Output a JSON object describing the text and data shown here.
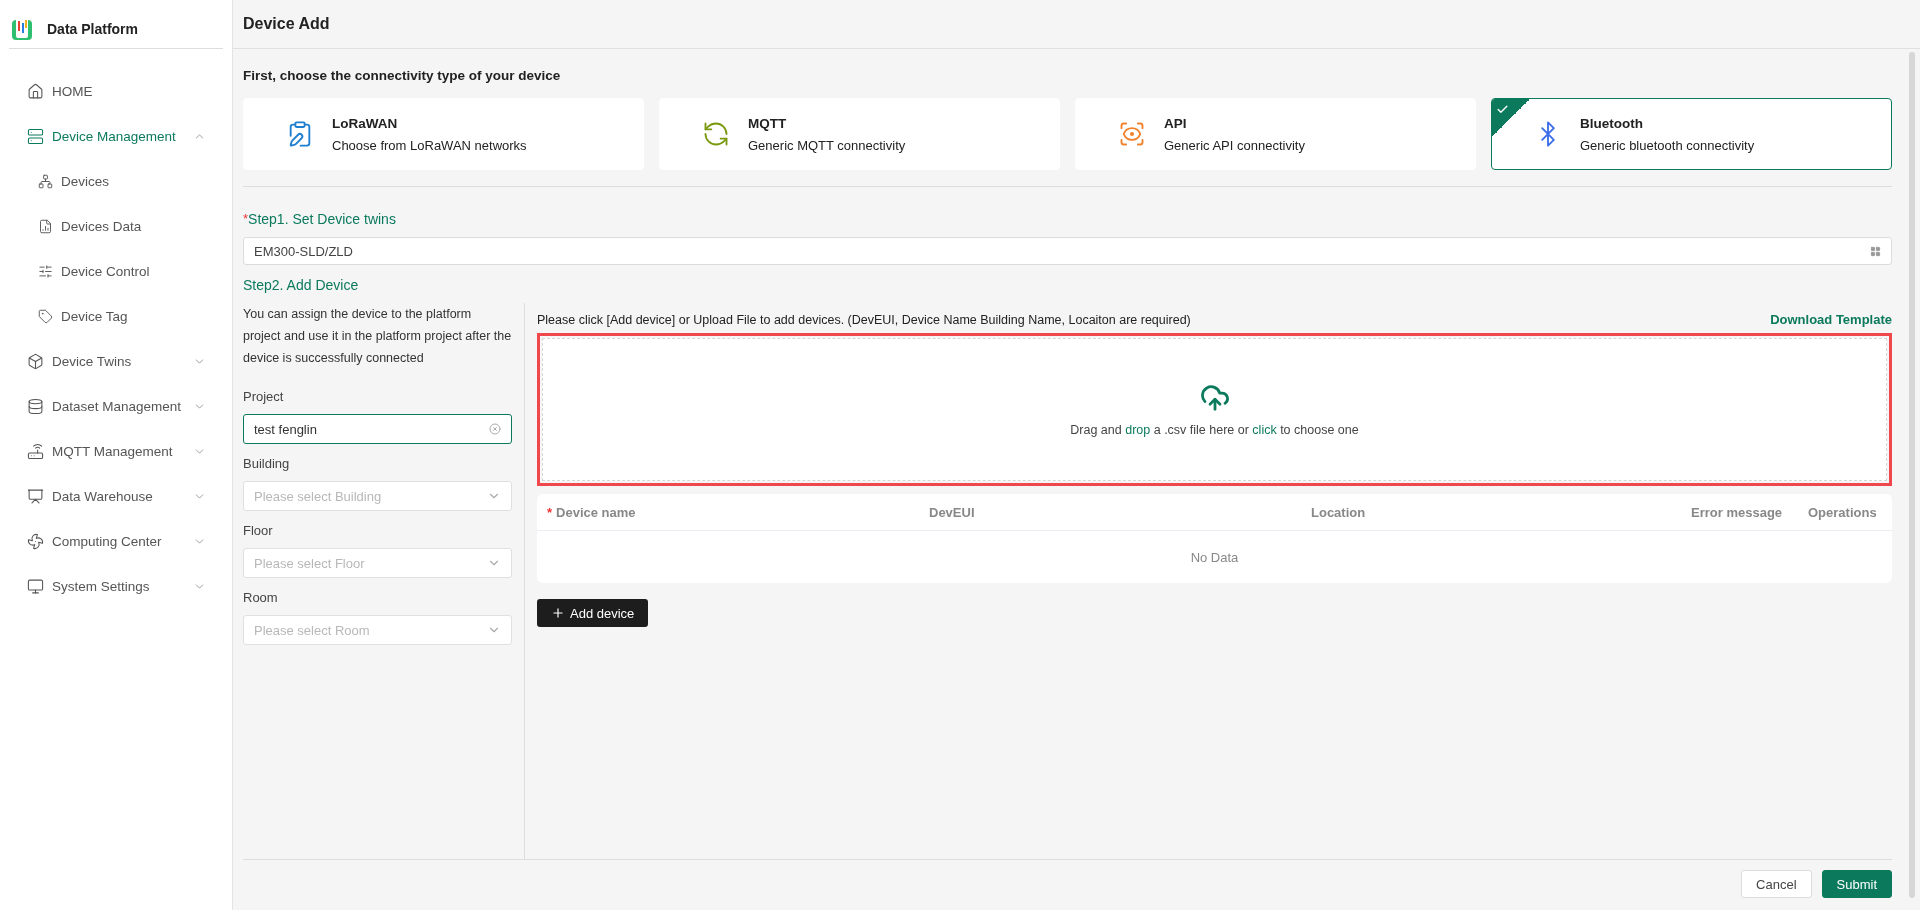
{
  "brand": {
    "name": "Data Platform"
  },
  "sidebar": {
    "items": [
      {
        "label": "HOME",
        "selected": false
      },
      {
        "label": "Device Management",
        "selected": true,
        "expanded": true,
        "children": [
          {
            "label": "Devices"
          },
          {
            "label": "Devices Data"
          },
          {
            "label": "Device Control"
          },
          {
            "label": "Device Tag"
          }
        ]
      },
      {
        "label": "Device Twins",
        "selected": false,
        "expanded": false
      },
      {
        "label": "Dataset Management",
        "selected": false,
        "expanded": false
      },
      {
        "label": "MQTT Management",
        "selected": false,
        "expanded": false
      },
      {
        "label": "Data Warehouse",
        "selected": false,
        "expanded": false
      },
      {
        "label": "Computing Center",
        "selected": false,
        "expanded": false
      },
      {
        "label": "System Settings",
        "selected": false,
        "expanded": false
      }
    ]
  },
  "page": {
    "title": "Device Add"
  },
  "connectivity": {
    "heading": "First, choose the connectivity type of your device",
    "options": [
      {
        "kind": "lorawan",
        "title": "LoRaWAN",
        "description": "Choose from LoRaWAN networks",
        "selected": false
      },
      {
        "kind": "mqtt",
        "title": "MQTT",
        "description": "Generic MQTT connectivity",
        "selected": false
      },
      {
        "kind": "api",
        "title": "API",
        "description": "Generic API connectivity",
        "selected": false
      },
      {
        "kind": "bluetooth",
        "title": "Bluetooth",
        "description": "Generic bluetooth connectivity",
        "selected": true
      }
    ]
  },
  "step1": {
    "marker": "*",
    "title": "Step1. Set Device twins",
    "value": "EM300-SLD/ZLD"
  },
  "step2": {
    "title": "Step2. Add Device",
    "hint": "You can assign the device to the platform project and use it in the platform project after the device is successfully connected",
    "fields": [
      {
        "label": "Project",
        "value": "test fenglin",
        "focused": true
      },
      {
        "label": "Building",
        "placeholder": "Please select Building",
        "focused": false
      },
      {
        "label": "Floor",
        "placeholder": "Please select Floor",
        "focused": false
      },
      {
        "label": "Room",
        "placeholder": "Please select Room",
        "focused": false
      }
    ],
    "instruction": "Please click [Add device] or Upload File to add devices. (DevEUI, Device Name Building Name, Locaiton are required)",
    "download_link": "Download Template",
    "upload": {
      "highlighted": true,
      "segments": [
        {
          "text": "Drag and ",
          "link": false
        },
        {
          "text": "drop",
          "link": true
        },
        {
          "text": " a .csv file here or ",
          "link": false
        },
        {
          "text": "click",
          "link": true
        },
        {
          "text": " to choose one",
          "link": false
        }
      ]
    },
    "table": {
      "columns": [
        {
          "marker": "*",
          "label": "Device name"
        },
        {
          "label": "DevEUI"
        },
        {
          "label": "Location"
        },
        {
          "label": "Error message"
        },
        {
          "label": "Operations"
        }
      ],
      "empty": "No Data"
    },
    "add_button": "Add device"
  },
  "footer": {
    "buttons": [
      {
        "label": "Cancel",
        "primary": false
      },
      {
        "label": "Submit",
        "primary": true
      }
    ]
  }
}
